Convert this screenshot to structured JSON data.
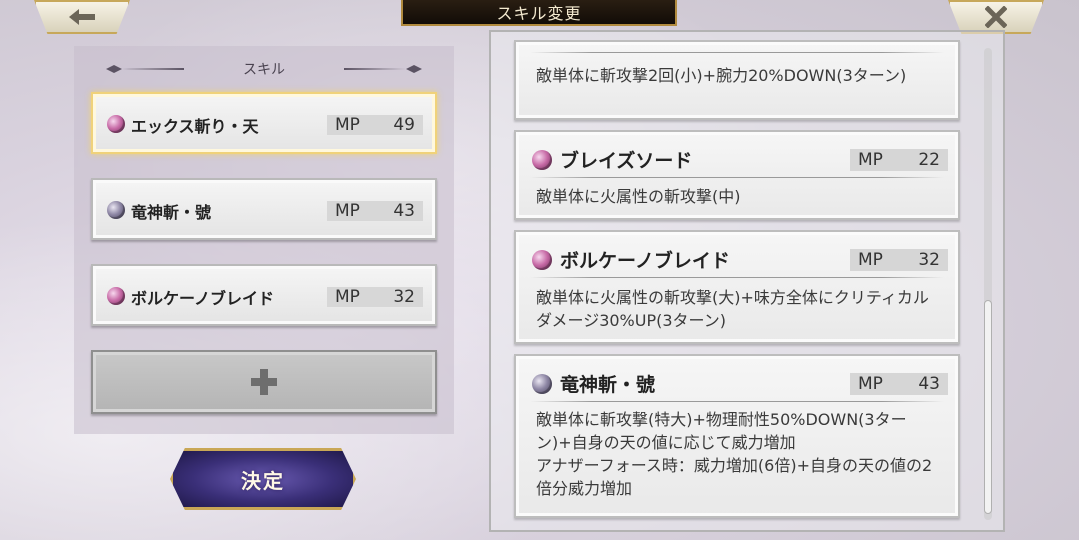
{
  "header": {
    "title": "スキル変更"
  },
  "left_panel": {
    "heading": "スキル",
    "slots": [
      {
        "name": "エックス斬り・天",
        "mp_label": "MP",
        "mp": "49",
        "icon": "pink-skill-orb-icon"
      },
      {
        "name": "竜神斬・號",
        "mp_label": "MP",
        "mp": "43",
        "icon": "gray-skill-orb-icon"
      },
      {
        "name": "ボルケーノブレイド",
        "mp_label": "MP",
        "mp": "32",
        "icon": "pink-skill-orb-icon"
      }
    ],
    "confirm_label": "決定"
  },
  "skill_list": [
    {
      "desc": "敵単体に斬攻撃2回(小)+腕力20%DOWN(3ターン)"
    },
    {
      "name": "ブレイズソード",
      "mp_label": "MP",
      "mp": "22",
      "desc": "敵単体に火属性の斬攻撃(中)"
    },
    {
      "name": "ボルケーノブレイド",
      "mp_label": "MP",
      "mp": "32",
      "desc": "敵単体に火属性の斬攻撃(大)+味方全体にクリティカルダメージ30%UP(3ターン)"
    },
    {
      "name": "竜神斬・號",
      "mp_label": "MP",
      "mp": "43",
      "desc": "敵単体に斬攻撃(特大)+物理耐性50%DOWN(3ターン)+自身の天の値に応じて威力増加\nアナザーフォース時：威力増加(6倍)+自身の天の値の2倍分威力増加"
    }
  ],
  "colors": {
    "accent_gold": "#c9a756",
    "selected_border": "#f0d27a",
    "confirm_purple": "#3a2f78",
    "orb_pink": "#c76aa6",
    "orb_gray": "#8d86a4"
  }
}
